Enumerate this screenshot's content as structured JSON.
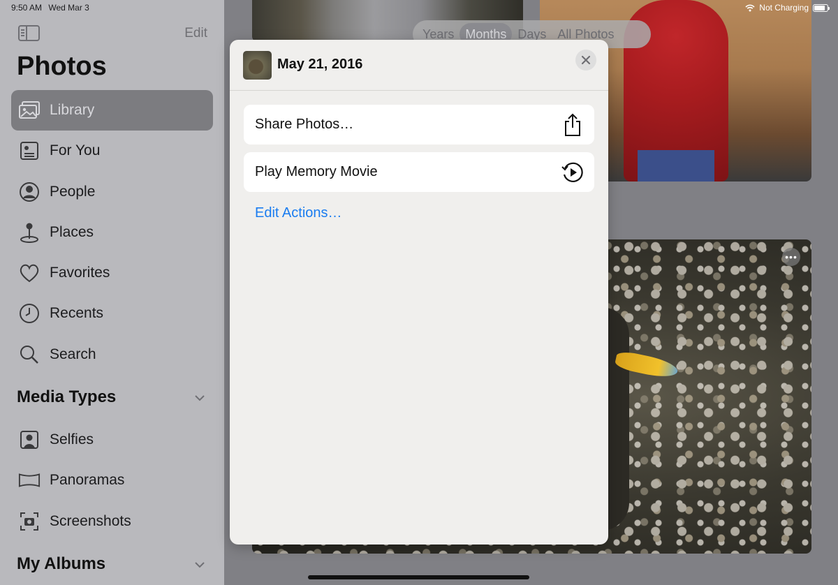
{
  "status_bar": {
    "time": "9:50 AM",
    "date": "Wed Mar 3",
    "charging": "Not Charging",
    "battery_level": 0.85
  },
  "sidebar": {
    "edit_label": "Edit",
    "title": "Photos",
    "items": [
      {
        "label": "Library",
        "icon": "library-icon",
        "selected": true
      },
      {
        "label": "For You",
        "icon": "for-you-icon"
      },
      {
        "label": "People",
        "icon": "people-icon"
      },
      {
        "label": "Places",
        "icon": "places-icon"
      },
      {
        "label": "Favorites",
        "icon": "heart-icon"
      },
      {
        "label": "Recents",
        "icon": "clock-icon"
      },
      {
        "label": "Search",
        "icon": "search-icon"
      }
    ],
    "media_types": {
      "header": "Media Types",
      "items": [
        {
          "label": "Selfies",
          "icon": "selfie-icon"
        },
        {
          "label": "Panoramas",
          "icon": "panorama-icon"
        },
        {
          "label": "Screenshots",
          "icon": "screenshot-icon"
        }
      ]
    },
    "my_albums": {
      "header": "My Albums"
    }
  },
  "view_switcher": {
    "options": [
      "Years",
      "Months",
      "Days",
      "All Photos"
    ],
    "selected": "Months"
  },
  "popover": {
    "title": "May 21, 2016",
    "actions": [
      {
        "label": "Share Photos…",
        "icon": "share-icon"
      },
      {
        "label": "Play Memory Movie",
        "icon": "play-memory-icon"
      }
    ],
    "edit_actions": "Edit Actions…"
  },
  "colors": {
    "accent": "#1a7cf0",
    "sidebar_bg": "#b9b9bd",
    "selected_bg": "#7c7c80",
    "popover_bg": "#f0efed"
  }
}
